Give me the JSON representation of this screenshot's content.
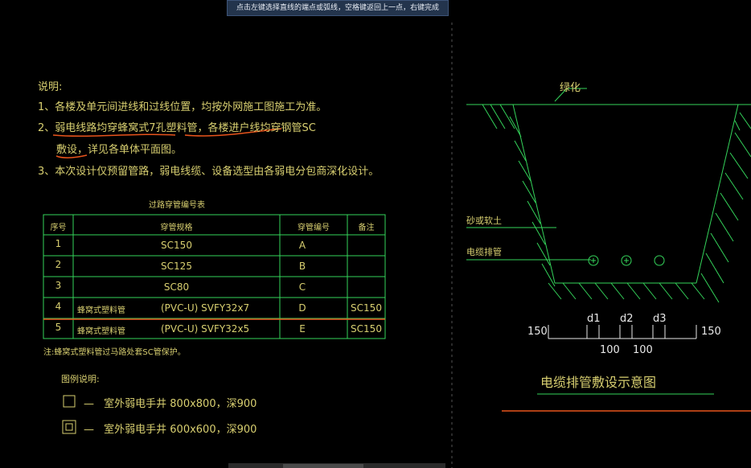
{
  "prompt": "点击左键选择直线的端点或弧线，空格键返回上一点，右键完成",
  "notes": {
    "title": "说明:",
    "line1": "1、各楼及单元间进线和过线位置，均按外网施工图施工为准。",
    "line2": "2、弱电线路均穿蜂窝式7孔塑料管，各楼进户线均穿钢管SC",
    "line2b": "敷设，详见各单体平面图。",
    "line3": "3、本次设计仅预留管路，弱电线缆、设备选型由各弱电分包商深化设计。"
  },
  "table": {
    "title": "过路穿管编号表",
    "headers": [
      "序号",
      "穿管规格",
      "穿管编号",
      "备注"
    ],
    "rows": [
      {
        "no": "1",
        "spec_name": "",
        "spec": "SC150",
        "code": "A",
        "remark": ""
      },
      {
        "no": "2",
        "spec_name": "",
        "spec": "SC125",
        "code": "B",
        "remark": ""
      },
      {
        "no": "3",
        "spec_name": "",
        "spec": "SC80",
        "code": "C",
        "remark": ""
      },
      {
        "no": "4",
        "spec_name": "蜂窝式塑料管",
        "spec": "(PVC-U) SVFY32x7",
        "code": "D",
        "remark": "SC150"
      },
      {
        "no": "5",
        "spec_name": "蜂窝式塑料管",
        "spec": "(PVC-U) SVFY32x5",
        "code": "E",
        "remark": "SC150"
      }
    ],
    "footnote": "注:蜂窝式塑料管过马路处套SC管保护。"
  },
  "legend": {
    "title": "图例说明:",
    "item1": "室外弱电手井 800x800，深900",
    "item2": "室外弱电手井 600x600，深900",
    "dash": "—"
  },
  "diagram": {
    "label_top": "绿化",
    "label_soil": "砂或软土",
    "label_pipe": "电缆排管",
    "dim_150_left": "150",
    "dim_150_right": "150",
    "dim_d1": "d1",
    "dim_d2": "d2",
    "dim_d3": "d3",
    "dim_100_a": "100",
    "dim_100_b": "100",
    "title": "电缆排管敷设示意图"
  },
  "colors": {
    "background": "#000000",
    "cad_text": "#d8cf70",
    "cad_lines": "#34d35a",
    "annotation": "#e8541c",
    "tooltip_bg": "#23344c"
  }
}
